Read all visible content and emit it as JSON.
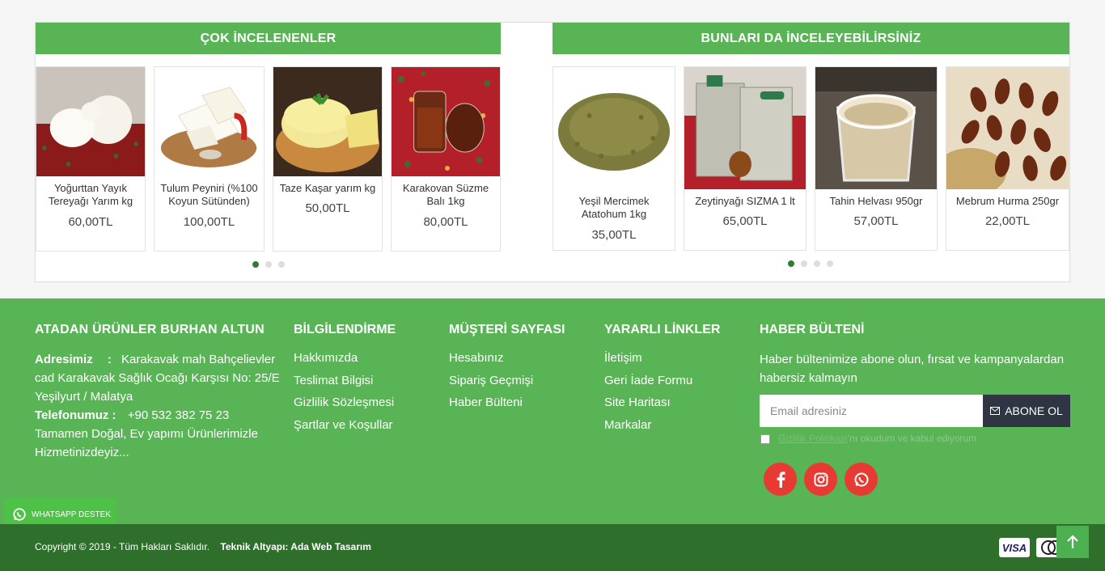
{
  "left_section": {
    "title": "ÇOK İNCELENENLER",
    "products": [
      {
        "name": "Yoğurttan Yayık Tereyağı Yarım kg",
        "price": "60,00TL",
        "image": "butter-image"
      },
      {
        "name": "Tulum Peyniri (%100 Koyun Sütünden)",
        "price": "100,00TL",
        "image": "cheese-image"
      },
      {
        "name": "Taze Kaşar yarım kg",
        "price": "50,00TL",
        "image": "kashar-image"
      },
      {
        "name": "Karakovan Süzme Balı 1kg",
        "price": "80,00TL",
        "image": "honey-image"
      }
    ]
  },
  "right_section": {
    "title": "BUNLARI DA İNCELEYEBİLİRSİNİZ",
    "products": [
      {
        "name": "Yeşil Mercimek Atatohum 1kg",
        "price": "35,00TL",
        "image": "lentil-image"
      },
      {
        "name": "Zeytinyağı SIZMA 1 lt",
        "price": "65,00TL",
        "image": "oil-tin-image"
      },
      {
        "name": "Tahin Helvası 950gr",
        "price": "57,00TL",
        "image": "halva-image"
      },
      {
        "name": "Mebrum Hurma 250gr",
        "price": "22,00TL",
        "image": "dates-image"
      }
    ]
  },
  "footer": {
    "col1": {
      "title": "ATADAN ÜRÜNLER BURHAN ALTUN",
      "address_label": "Adresimiz",
      "address_sep": ":",
      "address": "Karakavak mah Bahçelievler cad Karakavak Sağlık Ocağı Karşısı No: 25/E  Yeşilyurt / Malatya",
      "phone_label": "Telefonumuz :",
      "phone": "+90 532 382 75 23",
      "slogan": "Tamamen Doğal, Ev yapımı Ürünlerimizle Hizmetinizdeyiz..."
    },
    "col2": {
      "title": "BİLGİLENDİRME",
      "links": [
        "Hakkımızda",
        "Teslimat Bilgisi",
        "Gizlilik Sözleşmesi",
        "Şartlar ve Koşullar"
      ]
    },
    "col3": {
      "title": "MÜŞTERİ SAYFASI",
      "links": [
        "Hesabınız",
        "Sipariş Geçmişi",
        "Haber Bülteni"
      ]
    },
    "col4": {
      "title": "YARARLI LİNKLER",
      "links": [
        "İletişim",
        "Geri İade Formu",
        "Site Haritası",
        "Markalar"
      ]
    },
    "newsletter": {
      "title": "HABER BÜLTENİ",
      "text": "Haber bültenimize abone olun, fırsat ve kampanyalardan habersiz kalmayın",
      "placeholder": "Email adresiniz",
      "button": "ABONE OL",
      "consent_link": "Gizlilik Politikası",
      "consent_text": "'nı okudum ve kabul ediyorum"
    },
    "social": [
      "facebook-icon",
      "instagram-icon",
      "whatsapp-icon"
    ]
  },
  "whatsapp": {
    "label": "WHATSAPP DESTEK"
  },
  "bottom": {
    "copyright": "Copyright © 2019 - Tüm Hakları Saklıdır.",
    "tech": "Teknik Altyapı: Ada Web Tasarım",
    "payment": [
      "VISA",
      "mastercard"
    ]
  },
  "colors": {
    "green": "#58b455",
    "dark_green": "#2e6f2c",
    "social_red": "#e63a33"
  }
}
